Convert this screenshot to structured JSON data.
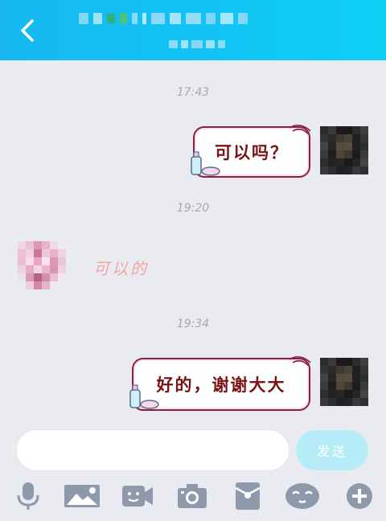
{
  "header": {
    "title": "",
    "subtitle": "",
    "colors": {
      "start": "#17b7f0",
      "end": "#0fd0f5"
    },
    "back_icon": "chevron-left-icon"
  },
  "messages": [
    {
      "type": "timestamp",
      "text": "17:43"
    },
    {
      "type": "sent",
      "text": "可以吗？"
    },
    {
      "type": "timestamp",
      "text": "19:20"
    },
    {
      "type": "received",
      "text": "可以的"
    },
    {
      "type": "timestamp",
      "text": "19:34"
    },
    {
      "type": "sent",
      "text": "好的，谢谢大大"
    }
  ],
  "input": {
    "placeholder": "",
    "send_label": "发送",
    "send_color": "#b5ecf8"
  },
  "toolbar": [
    {
      "name": "microphone-icon"
    },
    {
      "name": "image-icon"
    },
    {
      "name": "video-call-icon"
    },
    {
      "name": "camera-icon"
    },
    {
      "name": "red-packet-icon"
    },
    {
      "name": "emoji-icon"
    },
    {
      "name": "plus-icon"
    }
  ],
  "colors": {
    "background": "#e9ebf1",
    "bubble_border": "#8a2040",
    "bubble_text": "#7a1212",
    "received_text": "#f3a4a4",
    "timestamp": "#a6a9b3",
    "icon": "#8e9aac"
  }
}
